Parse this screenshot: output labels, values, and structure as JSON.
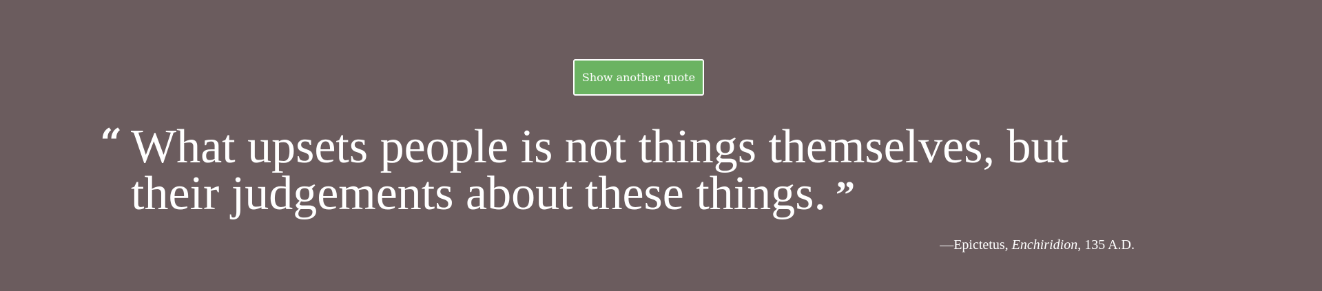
{
  "button": {
    "label": "Show another quote",
    "background_color": "#6bb362",
    "border_color": "#ffffff"
  },
  "quote": {
    "open_mark": "“",
    "text": "What upsets people is not things themselves, but their judgements about these things.",
    "close_mark": "”"
  },
  "citation": {
    "prefix": "—",
    "author": "Epictetus",
    "separator": ", ",
    "work": "Enchiridion",
    "date": ", 135 A.D."
  },
  "page": {
    "background_color": "#6b5c5e",
    "text_color": "#ffffff"
  }
}
